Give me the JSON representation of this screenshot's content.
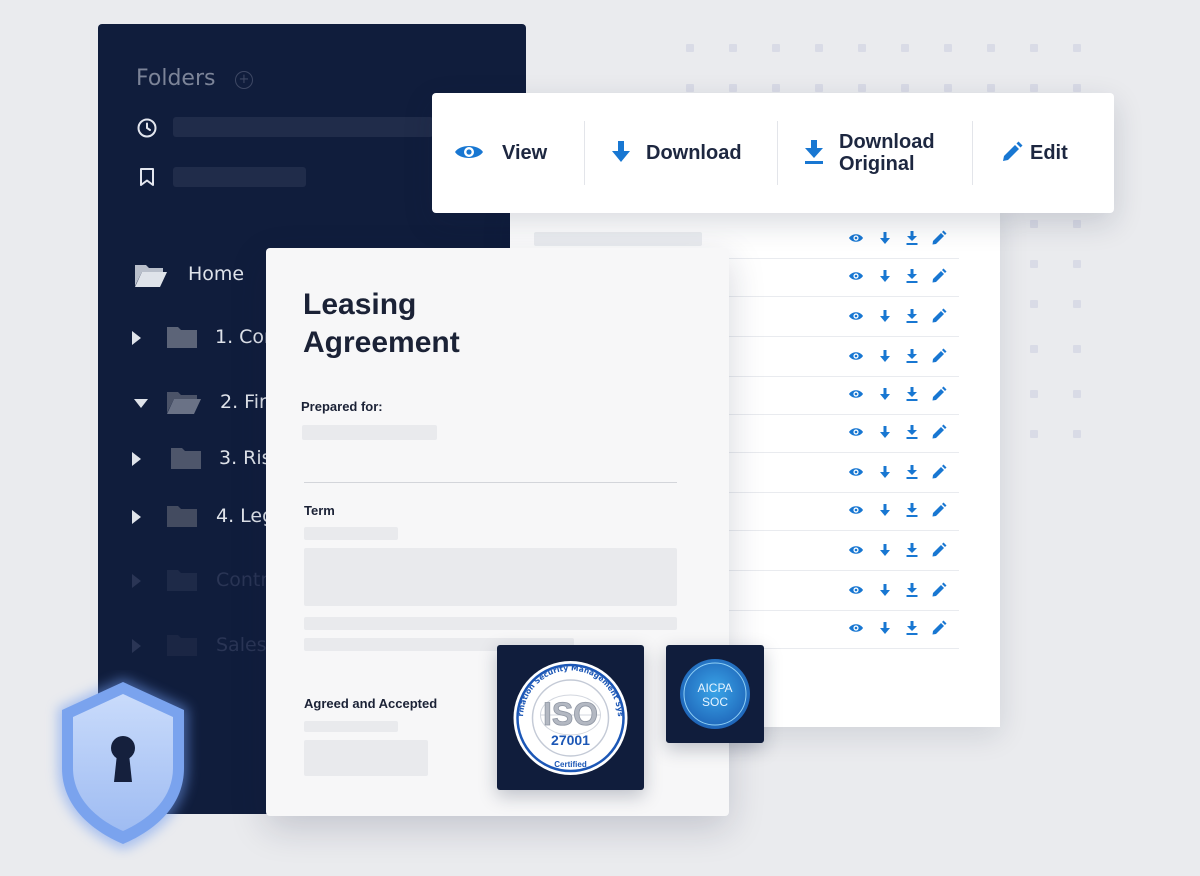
{
  "sidebar": {
    "title": "Folders",
    "add_icon": "plus-circle-icon",
    "recent_icon": "clock-icon",
    "bookmark_icon": "bookmark-icon",
    "home_label": "Home",
    "folders": [
      {
        "label": "1. Cor",
        "expanded": false,
        "dim": false
      },
      {
        "label": "2. Fin",
        "expanded": true,
        "dim": false
      },
      {
        "label": "3. Ris",
        "expanded": false,
        "dim": false
      },
      {
        "label": "4. Leg",
        "expanded": false,
        "dim": false
      },
      {
        "label": "Contr",
        "expanded": false,
        "dim": true
      },
      {
        "label": "Sales",
        "expanded": false,
        "dim": true
      }
    ]
  },
  "toolbar": {
    "view_label": "View",
    "download_label": "Download",
    "download_original_line1": "Download",
    "download_original_line2": "Original",
    "edit_label": "Edit",
    "accent_color": "#1877d2"
  },
  "document": {
    "title_line1": "Leasing",
    "title_line2": "Agreement",
    "prepared_for_label": "Prepared for:",
    "term_label": "Term",
    "agreed_label": "Agreed and Accepted"
  },
  "badges": {
    "iso_ring_text": "Information Security Management System",
    "iso_main": "ISO",
    "iso_number": "27001",
    "iso_bottom": "Certified",
    "aicpa_line1": "AICPA",
    "aicpa_line2": "SOC"
  },
  "shield": {
    "icon": "shield-keyhole-icon",
    "color": "#a9c4f5"
  },
  "file_rows_count": 11
}
